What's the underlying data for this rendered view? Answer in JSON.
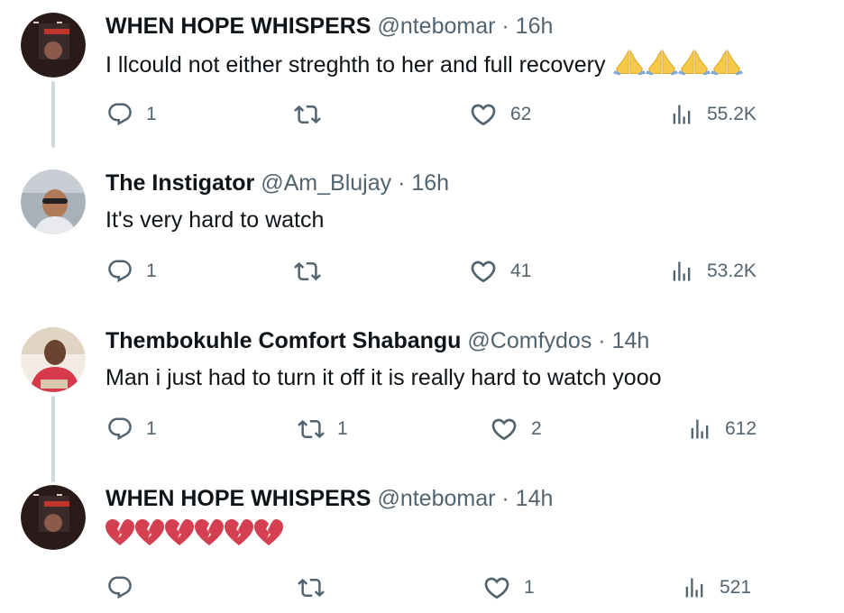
{
  "replies": [
    {
      "name": "WHEN HOPE WHISPERS",
      "handle": "@ntebomar",
      "sep": "·",
      "time": "16h",
      "text": "I llcould not either streghth to her and full recovery",
      "emoji": "pray-emoji x4",
      "stats": {
        "replies": "1",
        "retweets": "",
        "likes": "62",
        "views": "55.2K"
      }
    },
    {
      "name": "The Instigator",
      "handle": "@Am_Blujay",
      "sep": "·",
      "time": "16h",
      "text": "It's very hard to watch",
      "stats": {
        "replies": "1",
        "retweets": "",
        "likes": "41",
        "views": "53.2K"
      }
    },
    {
      "name": "Thembokuhle Comfort Shabangu",
      "handle": "@Comfydos",
      "sep": "·",
      "time": "14h",
      "text": "Man i just had to turn it off it is really hard to watch yooo",
      "stats": {
        "replies": "1",
        "retweets": "1",
        "likes": "2",
        "views": "612"
      }
    },
    {
      "name": "WHEN HOPE WHISPERS",
      "handle": "@ntebomar",
      "sep": "·",
      "time": "14h",
      "text": "",
      "emoji": "broken-heart-emoji x6",
      "stats": {
        "replies": "",
        "retweets": "",
        "likes": "1",
        "views": "521"
      }
    }
  ],
  "icons": [
    "reply-icon",
    "retweet-icon",
    "like-icon",
    "views-icon"
  ],
  "colors": {
    "text": "#0f1419",
    "muted": "#536471",
    "thread": "#cfd9de",
    "heart": "#d43f52",
    "pray": "#f7c948"
  }
}
